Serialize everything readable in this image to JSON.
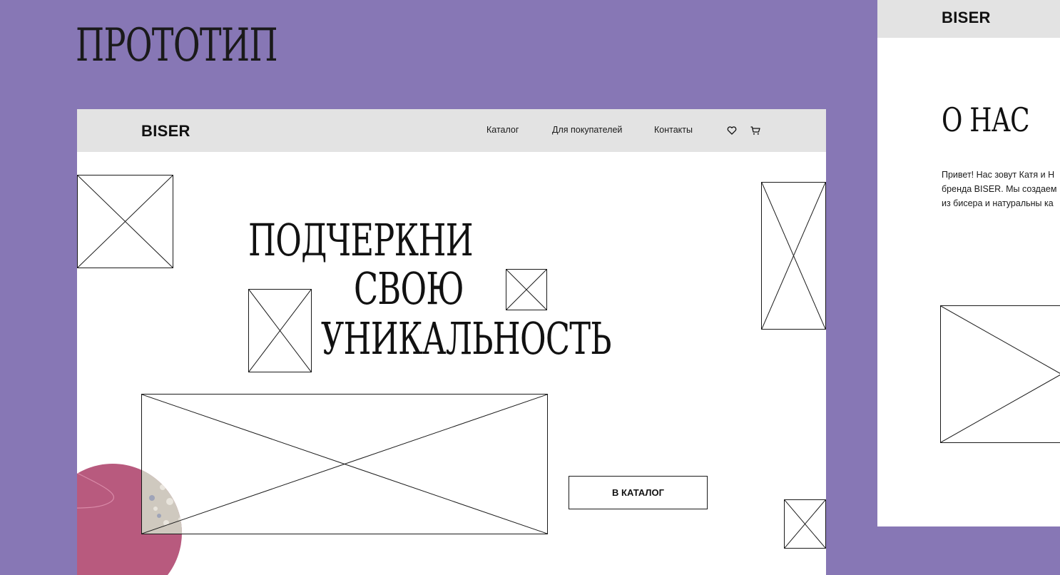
{
  "page": {
    "heading": "ПРОТОТИП",
    "background": "#8777b5"
  },
  "main_frame": {
    "header": {
      "logo": "BISER",
      "nav": [
        {
          "label": "Каталог"
        },
        {
          "label": "Для покупателей"
        },
        {
          "label": "Контакты"
        }
      ],
      "icons": [
        "heart-icon",
        "cart-icon"
      ]
    },
    "hero": {
      "lines": [
        "ПОДЧЕРКНИ",
        "СВОЮ",
        "УНИКАЛЬНОСТЬ"
      ],
      "cta_label": "В КАТАЛОГ"
    },
    "decor_colors": {
      "circle": "#b85a7e",
      "photo": "#cfc9bf"
    }
  },
  "right_frame": {
    "header": {
      "logo": "BISER"
    },
    "about": {
      "title": "О НАС",
      "text_lines": [
        "Привет! Нас зовут Катя и Н",
        "бренда BISER. Мы создаем",
        "из бисера и натуральны ка"
      ]
    }
  }
}
